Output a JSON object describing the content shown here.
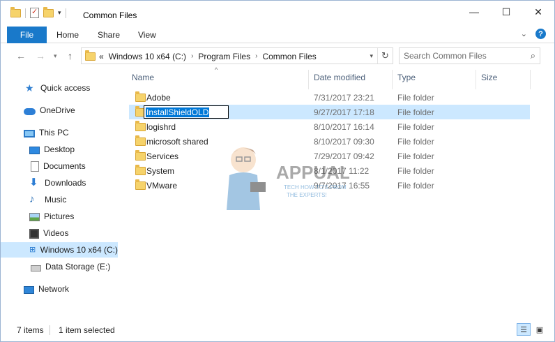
{
  "window": {
    "title": "Common Files",
    "quick_access_toolbar": [
      "folder-icon",
      "properties-icon",
      "new-folder-icon",
      "customize-dropdown"
    ],
    "controls": {
      "minimize": "—",
      "maximize": "☐",
      "close": "✕"
    }
  },
  "ribbon": {
    "tabs": [
      {
        "label": "File",
        "active": true
      },
      {
        "label": "Home"
      },
      {
        "label": "Share"
      },
      {
        "label": "View"
      }
    ],
    "accent_color": "#1979ca"
  },
  "navigation": {
    "address": {
      "overflow": "«",
      "crumbs": [
        "Windows 10 x64 (C:)",
        "Program Files",
        "Common Files"
      ]
    },
    "search": {
      "placeholder": "Search Common Files"
    }
  },
  "sidebar": {
    "items": [
      {
        "label": "Quick access",
        "icon": "star-icon"
      },
      {
        "label": "OneDrive",
        "icon": "cloud-icon"
      },
      {
        "label": "This PC",
        "icon": "computer-icon"
      },
      {
        "label": "Desktop",
        "icon": "desktop-icon"
      },
      {
        "label": "Documents",
        "icon": "documents-icon"
      },
      {
        "label": "Downloads",
        "icon": "download-arrow-icon"
      },
      {
        "label": "Music",
        "icon": "music-note-icon"
      },
      {
        "label": "Pictures",
        "icon": "pictures-icon"
      },
      {
        "label": "Videos",
        "icon": "videos-icon"
      },
      {
        "label": "Windows 10 x64 (C:)",
        "icon": "windows-drive-icon",
        "selected": true
      },
      {
        "label": "Data Storage (E:)",
        "icon": "drive-icon"
      },
      {
        "label": "Network",
        "icon": "network-icon"
      }
    ]
  },
  "file_list": {
    "columns": {
      "name": "Name",
      "date": "Date modified",
      "type": "Type",
      "size": "Size"
    },
    "sorted_by": "Name",
    "rows": [
      {
        "name": "Adobe",
        "date": "7/31/2017 23:21",
        "type": "File folder"
      },
      {
        "name": "InstallShieldOLD",
        "date": "9/27/2017 17:18",
        "type": "File folder",
        "selected": true,
        "renaming": true
      },
      {
        "name": "logishrd",
        "date": "8/10/2017 16:14",
        "type": "File folder"
      },
      {
        "name": "microsoft shared",
        "date": "8/10/2017 09:30",
        "type": "File folder"
      },
      {
        "name": "Services",
        "date": "7/29/2017 09:42",
        "type": "File folder"
      },
      {
        "name": "System",
        "date": "8/1/2017 11:22",
        "type": "File folder"
      },
      {
        "name": "VMware",
        "date": "9/7/2017 16:55",
        "type": "File folder"
      }
    ]
  },
  "watermark": {
    "brand": "APPUALS",
    "tagline_1": "TECH HOW-TO'S FROM",
    "tagline_2": "THE EXPERTS!"
  },
  "status": {
    "item_count": "7 items",
    "selection": "1 item selected"
  }
}
